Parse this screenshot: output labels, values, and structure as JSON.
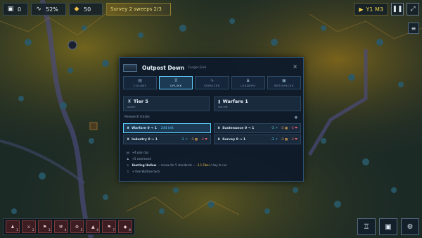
{
  "hud": {
    "resource1_value": "0",
    "resource2_value": "52%",
    "resource3_value": "50",
    "survey_text": "Survey 2 sweeps 2/3",
    "year_label": "Y1 M3",
    "icons": {
      "resource1": "box-icon",
      "resource2": "signal-icon",
      "resource3": "coin-icon"
    }
  },
  "modal": {
    "title": "Outpost Down",
    "subtitle": "Fungal Grid",
    "close_glyph": "×",
    "tabs": [
      {
        "icon": "▤",
        "label": "COLONY"
      },
      {
        "icon": "♖",
        "label": "UPLINK"
      },
      {
        "icon": "∿",
        "label": "SERVICES"
      },
      {
        "icon": "♟",
        "label": "LEADERS"
      },
      {
        "icon": "▣",
        "label": "RESOURCES"
      }
    ],
    "active_tab": 1,
    "tier": {
      "label": "Tier 5",
      "sub": "uplink"
    },
    "warfare": {
      "label": "Warfare 1",
      "sub": "not left"
    },
    "research_label": "Research tracks",
    "tracks": [
      {
        "name": "Warfare 0 → 1",
        "left": "244 left",
        "costs": []
      },
      {
        "name": "Sustenance 0 → 1",
        "left": "",
        "costs": [
          "-3 ↗",
          "-3 ▦",
          "-3 ❤"
        ]
      },
      {
        "name": "Industry 0 → 1",
        "left": "",
        "costs": [
          "-3 ↗",
          "-3 ▦",
          "-3 ❤"
        ]
      },
      {
        "name": "Survey 0 → 1",
        "left": "",
        "costs": [
          "-3 ↗",
          "-3 ▦",
          "-3 ❤"
        ]
      }
    ],
    "notes": [
      {
        "icon": "▤",
        "text": "+4 pop cap"
      },
      {
        "icon": "♟",
        "text": "+5 command"
      },
      {
        "icon": "♕",
        "bold": "Hunting Hollow",
        "text": " — renew for 5 standards — ",
        "warn": "-3.1 Fiber",
        "tail": " / day to run"
      },
      {
        "icon": "♖",
        "text": "+ free Warfare tech"
      }
    ]
  },
  "bottom": {
    "slots": [
      "1",
      "2",
      "3",
      "4",
      "5",
      "6",
      "7",
      "8"
    ],
    "slot_icons": [
      "♟",
      "⚔",
      "⚑",
      "⚒",
      "⚙",
      "▲",
      "⚑",
      "◆"
    ],
    "buttons": [
      "♖",
      "▣",
      "⚙"
    ]
  },
  "colors": {
    "accent": "#5fd1ff",
    "modal_bg": "#0f1b2a",
    "cost_cyan": "#4fd1e8",
    "cost_orange": "#e8a64a",
    "cost_red": "#ff6b6b"
  }
}
